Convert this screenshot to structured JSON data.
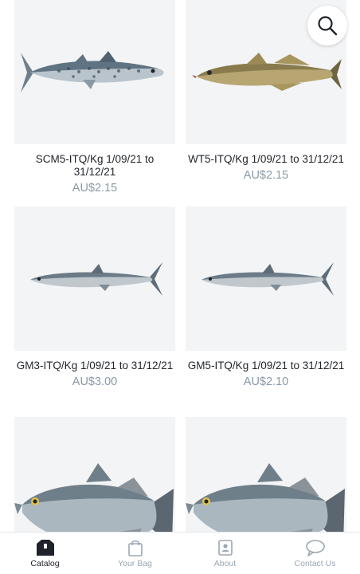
{
  "products": [
    {
      "title": "SCM5-ITQ/Kg 1/09/21 to 31/12/21",
      "price": "AU$2.15",
      "image": "spotted-mackerel"
    },
    {
      "title": "WT5-ITQ/Kg 1/09/21 to 31/12/21",
      "price": "AU$2.15",
      "image": "whiting"
    },
    {
      "title": "GM3-ITQ/Kg 1/09/21 to 31/12/21",
      "price": "AU$3.00",
      "image": "grey-mackerel"
    },
    {
      "title": "GM5-ITQ/Kg 1/09/21 to 31/12/21",
      "price": "AU$2.10",
      "image": "grey-mackerel"
    },
    {
      "title": "",
      "price": "",
      "image": "barramundi"
    },
    {
      "title": "",
      "price": "",
      "image": "barramundi"
    }
  ],
  "search": {
    "icon": "search-icon"
  },
  "tabs": [
    {
      "label": "Catalog",
      "icon": "box-icon",
      "active": true
    },
    {
      "label": "Your Bag",
      "icon": "bag-icon",
      "active": false
    },
    {
      "label": "About",
      "icon": "contact-card-icon",
      "active": false
    },
    {
      "label": "Contact Us",
      "icon": "chat-bubble-icon",
      "active": false
    }
  ],
  "colors": {
    "card_bg": "#f3f4f6",
    "price": "#8a99a8",
    "tab_inactive": "#9aa7b4",
    "tab_active": "#1f2329"
  }
}
